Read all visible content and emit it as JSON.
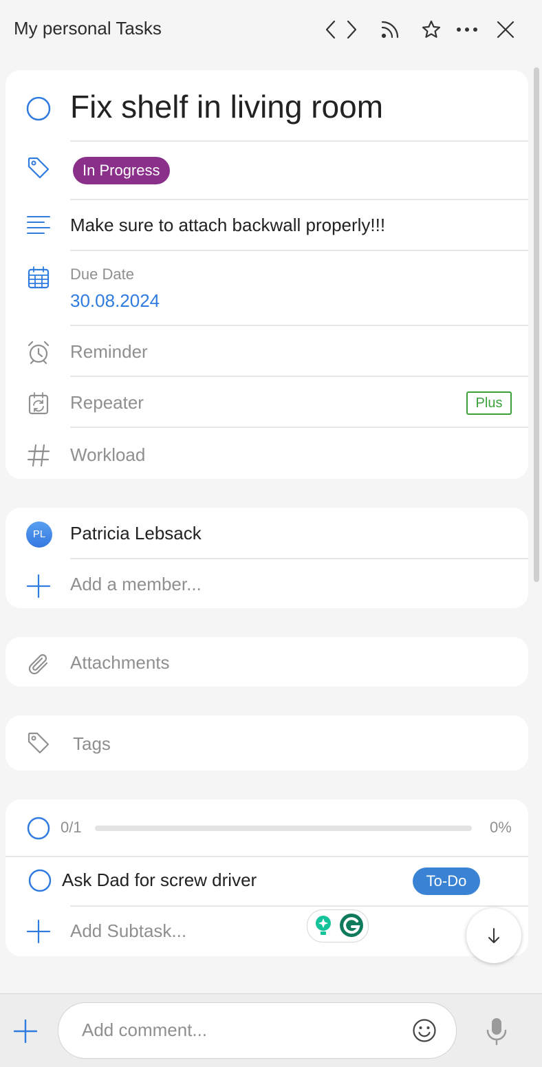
{
  "header": {
    "title": "My personal Tasks",
    "icons": [
      "chevron-left-icon",
      "chevron-right-icon",
      "rss-icon",
      "star-icon",
      "more-icon",
      "close-icon"
    ]
  },
  "task": {
    "title": "Fix shelf in living room",
    "status_label": "In Progress",
    "status_color": "#8a2f8a",
    "description": "Make sure to attach backwall properly!!!",
    "due_date_label": "Due Date",
    "due_date_value": "30.08.2024",
    "reminder_label": "Reminder",
    "repeater_label": "Repeater",
    "plus_badge": "Plus",
    "workload_label": "Workload"
  },
  "members": {
    "items": [
      {
        "initials": "PL",
        "name": "Patricia Lebsack"
      }
    ],
    "add_placeholder": "Add a member..."
  },
  "attachments_label": "Attachments",
  "tags_label": "Tags",
  "subtasks": {
    "count": "0/1",
    "percent": "0%",
    "progress": 0,
    "items": [
      {
        "title": "Ask Dad for screw driver",
        "status": "To-Do"
      }
    ],
    "add_placeholder": "Add Subtask..."
  },
  "comment": {
    "placeholder": "Add comment..."
  },
  "colors": {
    "accent": "#2f7be0",
    "todo": "#3a83d4",
    "plus": "#3aa13a"
  }
}
